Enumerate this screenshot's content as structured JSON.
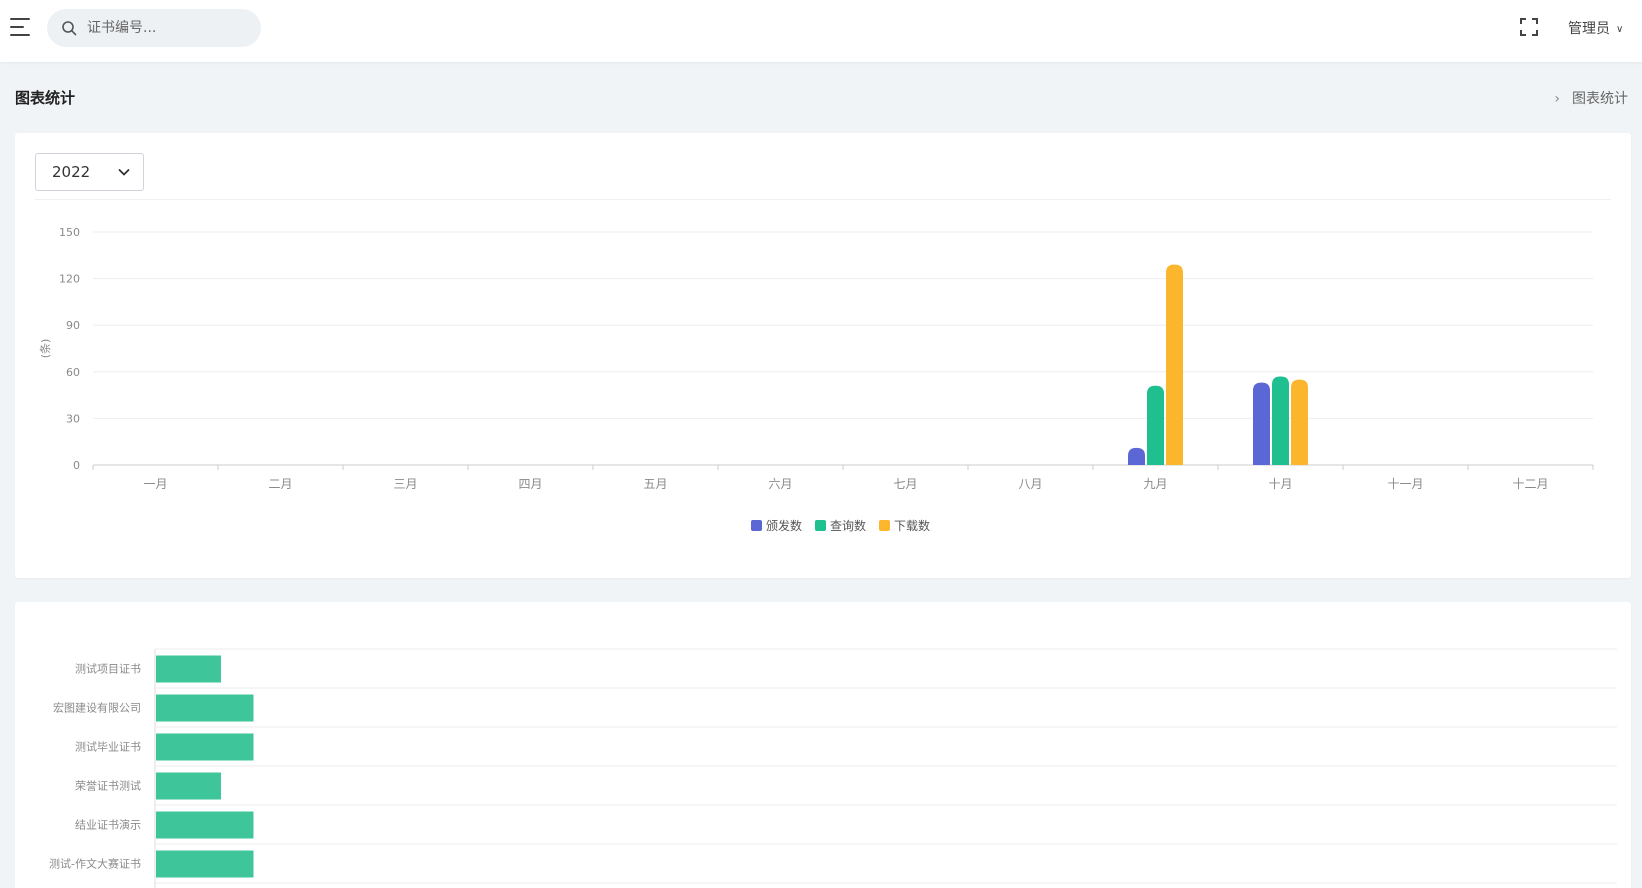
{
  "search": {
    "placeholder": "证书编号..."
  },
  "header": {
    "user_label": "管理员"
  },
  "page": {
    "title": "图表统计",
    "breadcrumb": "图表统计"
  },
  "filter": {
    "year": "2022"
  },
  "colors": {
    "issued": "#5b67d4",
    "queried": "#1fbf8f",
    "downloaded": "#fbb62e",
    "bar": "#3ec599"
  },
  "chart_data": [
    {
      "type": "bar",
      "title": "",
      "xlabel": "",
      "ylabel": "(条)",
      "ylim": [
        0,
        150
      ],
      "yticks": [
        0,
        30,
        60,
        90,
        120,
        150
      ],
      "grid": true,
      "legend_position": "bottom-center",
      "categories": [
        "一月",
        "二月",
        "三月",
        "四月",
        "五月",
        "六月",
        "七月",
        "八月",
        "九月",
        "十月",
        "十一月",
        "十二月"
      ],
      "series": [
        {
          "name": "颁发数",
          "color": "#5b67d4",
          "values": [
            0,
            0,
            0,
            0,
            0,
            0,
            0,
            0,
            11,
            53,
            0,
            0
          ]
        },
        {
          "name": "查询数",
          "color": "#1fbf8f",
          "values": [
            0,
            0,
            0,
            0,
            0,
            0,
            0,
            0,
            51,
            57,
            0,
            0
          ]
        },
        {
          "name": "下载数",
          "color": "#fbb62e",
          "values": [
            0,
            0,
            0,
            0,
            0,
            0,
            0,
            0,
            129,
            55,
            0,
            0
          ]
        }
      ]
    },
    {
      "type": "bar",
      "orientation": "horizontal",
      "title": "",
      "categories": [
        "测试项目证书",
        "宏图建设有限公司",
        "测试毕业证书",
        "荣誉证书测试",
        "结业证书演示",
        "测试-作文大赛证书"
      ],
      "values": [
        2,
        3,
        3,
        2,
        3,
        3
      ],
      "xlim": [
        0,
        45
      ],
      "color": "#3ec599"
    }
  ]
}
